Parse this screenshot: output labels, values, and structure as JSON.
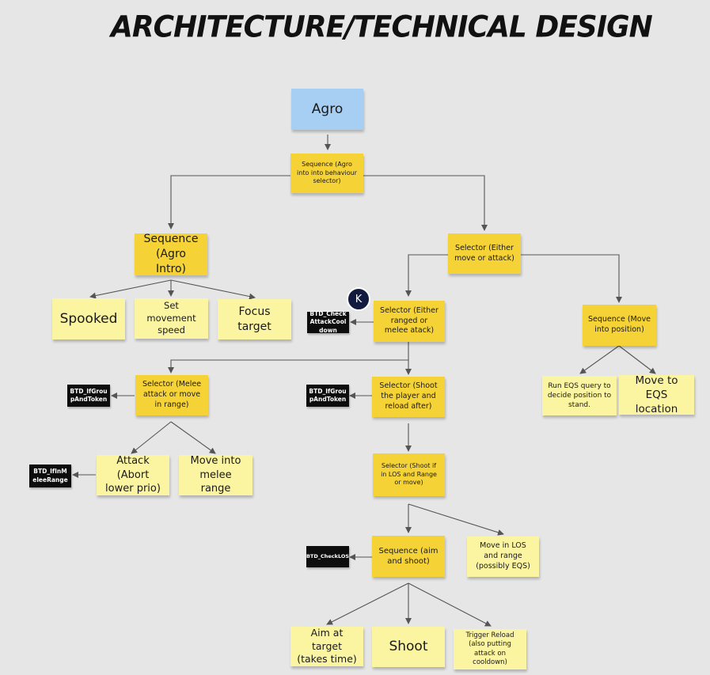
{
  "title": "ARCHITECTURE/TECHNICAL DESIGN",
  "avatar_initial": "K",
  "colors": {
    "background": "#e6e6e6",
    "sticky_yellow": "#f5d236",
    "sticky_pale": "#fbf4a1",
    "sticky_blue": "#a7cef3",
    "tag_black": "#0d0d0d",
    "connector": "#555555"
  },
  "notes": {
    "agro": "Agro",
    "seq_agro": "Sequence (Agro into into behaviour selector)",
    "seq_agro_intro": "Sequence (Agro Intro)",
    "spooked": "Spooked",
    "set_speed": "Set movement speed",
    "focus_target": "Focus target",
    "sel_move_attack": "Selector (Either move or attack)",
    "sel_ranged_melee": "Selector (Either ranged or melee atack)",
    "seq_move_position": "Sequence (Move into position)",
    "run_eqs": "Run EQS query to decide position to stand.",
    "move_eqs": "Move to EQS location",
    "sel_melee": "Selector (Melee attack or move in range)",
    "attack_abort": "Attack (Abort lower prio)",
    "move_melee": "Move into melee range",
    "sel_shoot_reload": "Selector (Shoot the player and reload after)",
    "sel_shoot_los": "Selector (Shoot if in LOS and Range or move)",
    "seq_aim_shoot": "Sequence (aim and shoot)",
    "move_los": "Move in LOS and range (possibly EQS)",
    "aim_target": "Aim at target (takes time)",
    "shoot": "Shoot",
    "trigger_reload": "Trigger Reload (also putting attack on cooldown)"
  },
  "tags": {
    "check_attack_cooldown": "BTD_CheckAttackCooldown",
    "if_group_token_melee": "BTD_IfGroupAndToken",
    "if_group_token_ranged": "BTD_IfGroupAndToken",
    "if_in_melee_range": "BTD_IfInMeleeRange",
    "check_los": "BTD_CheckLOS"
  }
}
